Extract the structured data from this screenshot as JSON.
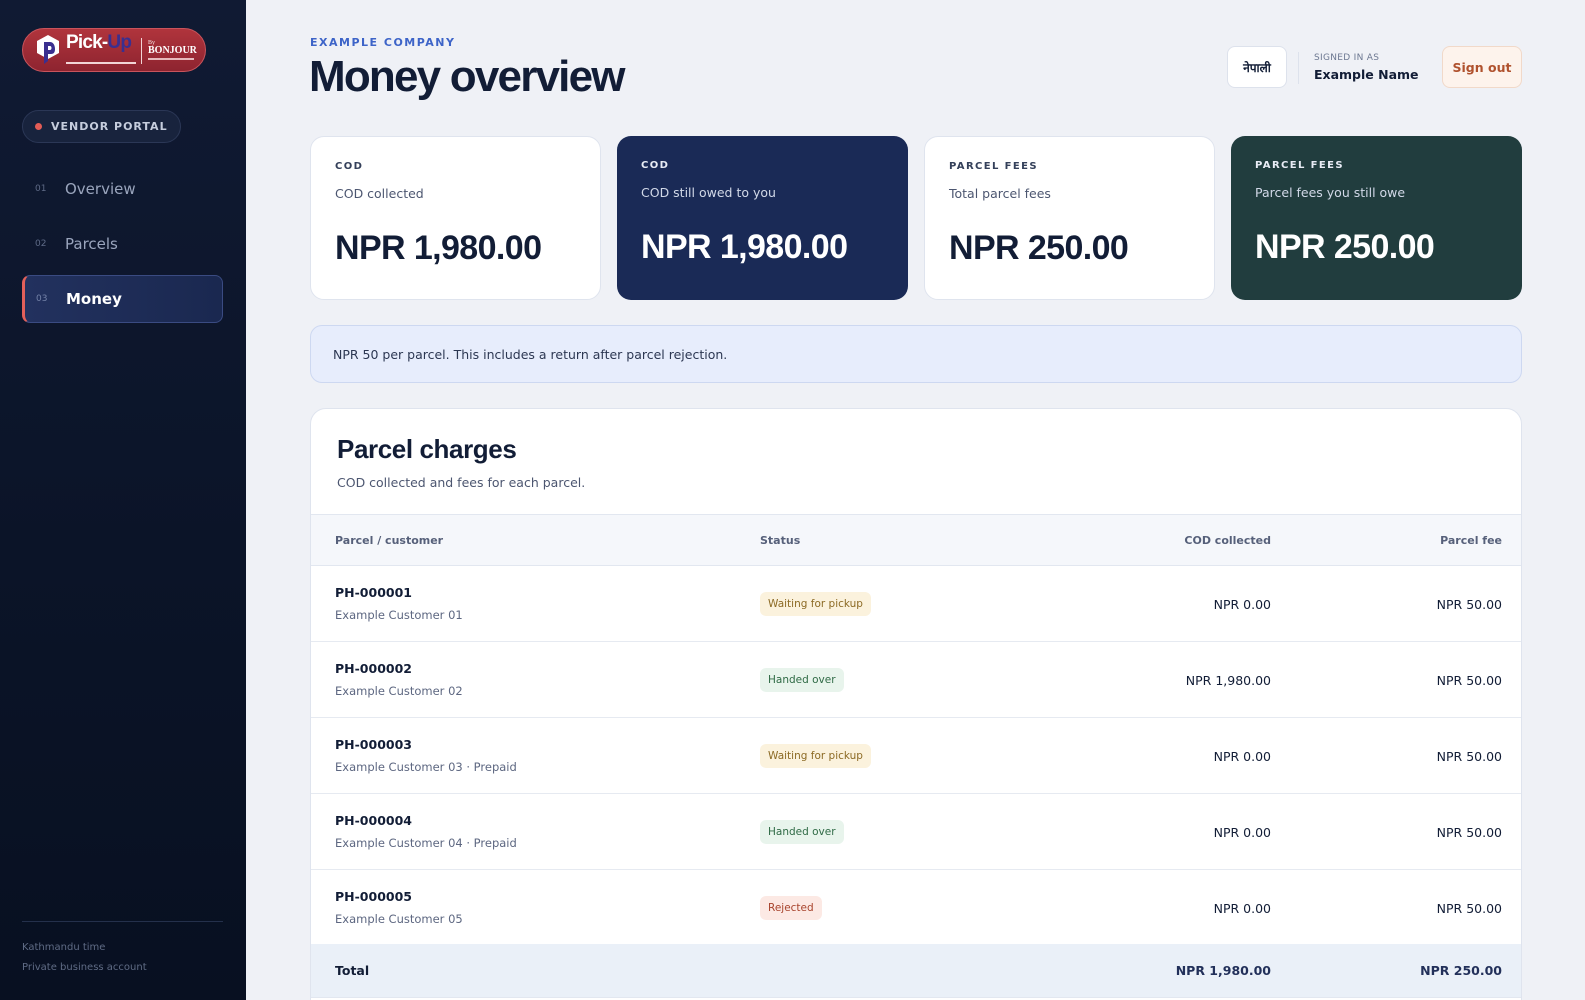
{
  "brand": {
    "word_a": "Pick-",
    "word_b": "Up",
    "by": "By",
    "partner": "BONJOUR"
  },
  "sidebar": {
    "badge": "VENDOR PORTAL",
    "items": [
      {
        "num": "01",
        "label": "Overview"
      },
      {
        "num": "02",
        "label": "Parcels"
      },
      {
        "num": "03",
        "label": "Money"
      }
    ],
    "active_index": 2,
    "footer": [
      "Kathmandu time",
      "Private business account"
    ]
  },
  "header": {
    "company": "EXAMPLE COMPANY",
    "title": "Money overview",
    "lang_button": "नेपाली",
    "signed_in_caption": "SIGNED IN AS",
    "user_name": "Example Name",
    "sign_out": "Sign out"
  },
  "cards": [
    {
      "kicker": "COD",
      "label": "COD collected",
      "value": "NPR 1,980.00"
    },
    {
      "kicker": "COD",
      "label": "COD still owed to you",
      "value": "NPR 1,980.00"
    },
    {
      "kicker": "PARCEL FEES",
      "label": "Total parcel fees",
      "value": "NPR 250.00"
    },
    {
      "kicker": "PARCEL FEES",
      "label": "Parcel fees you still owe",
      "value": "NPR 250.00"
    }
  ],
  "info_note": "NPR 50 per parcel. This includes a return after parcel rejection.",
  "charges": {
    "title": "Parcel charges",
    "subtitle": "COD collected and fees for each parcel.",
    "columns": [
      "Parcel / customer",
      "Status",
      "COD collected",
      "Parcel fee"
    ],
    "rows": [
      {
        "id": "PH-000001",
        "customer": "Example Customer 01",
        "status": "Waiting for pickup",
        "cod": "NPR 0.00",
        "fee": "NPR 50.00"
      },
      {
        "id": "PH-000002",
        "customer": "Example Customer 02",
        "status": "Handed over",
        "cod": "NPR 1,980.00",
        "fee": "NPR 50.00"
      },
      {
        "id": "PH-000003",
        "customer": "Example Customer 03 · Prepaid",
        "status": "Waiting for pickup",
        "cod": "NPR 0.00",
        "fee": "NPR 50.00"
      },
      {
        "id": "PH-000004",
        "customer": "Example Customer 04 · Prepaid",
        "status": "Handed over",
        "cod": "NPR 0.00",
        "fee": "NPR 50.00"
      },
      {
        "id": "PH-000005",
        "customer": "Example Customer 05",
        "status": "Rejected",
        "cod": "NPR 0.00",
        "fee": "NPR 50.00"
      }
    ],
    "total": {
      "label": "Total",
      "cod": "NPR 1,980.00",
      "fee": "NPR 250.00"
    }
  },
  "colors": {
    "accent": "#3d64c8",
    "active_marker": "#e2605a",
    "card_navy": "#1a2a56",
    "card_green": "#213d3e"
  }
}
